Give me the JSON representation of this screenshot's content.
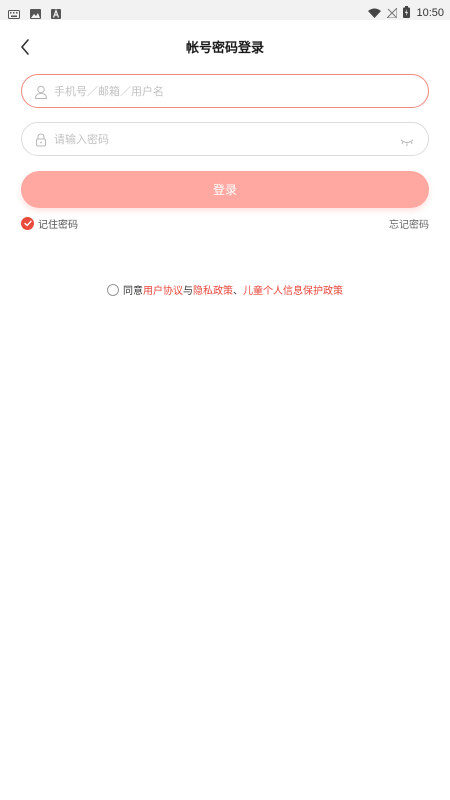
{
  "status_bar": {
    "time": "10:50",
    "icons": [
      "keyboard-icon",
      "image-icon",
      "font-a-icon",
      "wifi-icon",
      "no-signal-icon",
      "battery-charging-icon"
    ]
  },
  "header": {
    "title": "帐号密码登录",
    "back_icon": "chevron-left-icon"
  },
  "form": {
    "account_placeholder": "手机号／邮箱／用户名",
    "password_placeholder": "请输入密码",
    "login_label": "登录",
    "remember_label": "记住密码",
    "forgot_label": "忘记密码"
  },
  "agreement": {
    "prefix": "同意",
    "user_agreement": "用户协议",
    "and": "与",
    "privacy_policy": "隐私政策",
    "sep": "、",
    "child_policy": "儿童个人信息保护政策"
  },
  "colors": {
    "accent": "#e8473b",
    "button": "#ffa8a2",
    "focus_border": "#f08a7e"
  }
}
